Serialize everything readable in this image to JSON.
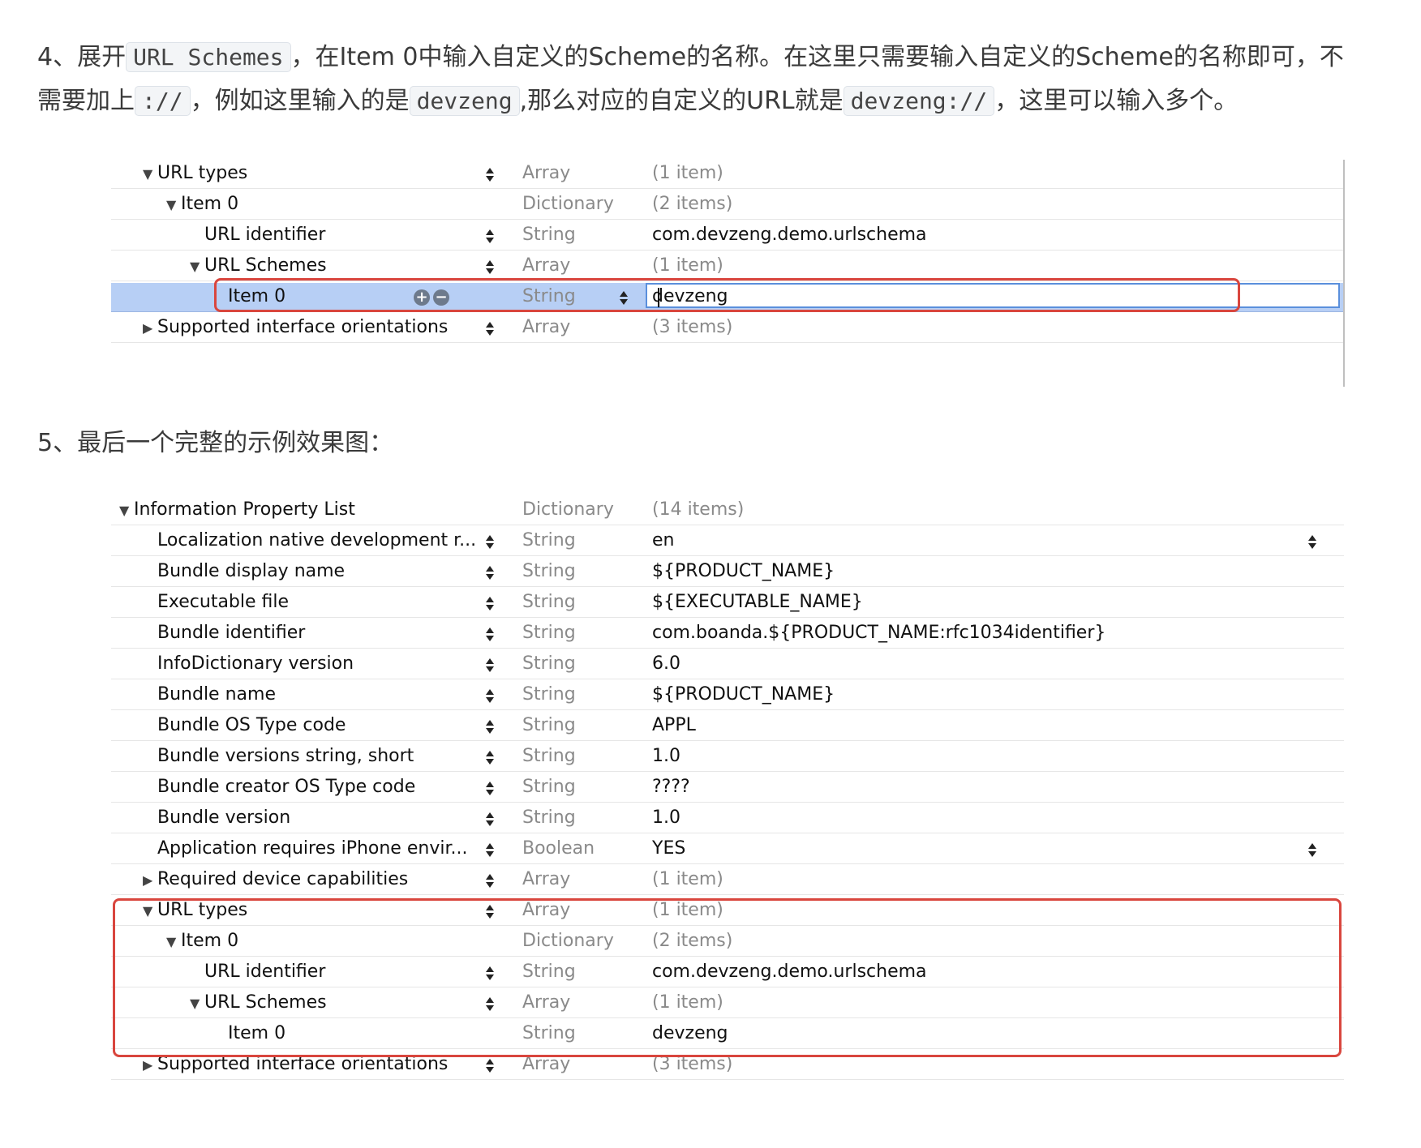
{
  "step4": {
    "line1": [
      {
        "t": "4、展开",
        "code": false
      },
      {
        "t": "URL Schemes",
        "code": true
      },
      {
        "t": "，在Item 0中输入自定义的Scheme的名称。在这里只需要输入自定义的Scheme的名称即可，不",
        "code": false
      }
    ],
    "line2": [
      {
        "t": "需要加上",
        "code": false
      },
      {
        "t": "://",
        "code": true
      },
      {
        "t": "，例如这里输入的是",
        "code": false
      },
      {
        "t": "devzeng",
        "code": true
      },
      {
        "t": ",那么对应的自定义的URL就是",
        "code": false
      },
      {
        "t": "devzeng://",
        "code": true
      },
      {
        "t": "，这里可以输入多个。",
        "code": false
      }
    ]
  },
  "plist1": {
    "rows": [
      {
        "key": "URL types",
        "indent": 0,
        "tri": "down",
        "stepper": true,
        "type": "Array",
        "value": "(1 item)",
        "vgrey": true
      },
      {
        "key": "Item 0",
        "indent": 1,
        "tri": "down",
        "stepper": false,
        "type": "Dictionary",
        "value": "(2 items)",
        "vgrey": true
      },
      {
        "key": "URL identifier",
        "indent": 2,
        "tri": "",
        "stepper": true,
        "type": "String",
        "value": "com.devzeng.demo.urlschema",
        "vgrey": false
      },
      {
        "key": "URL Schemes",
        "indent": 2,
        "tri": "down",
        "stepper": true,
        "type": "Array",
        "value": "(1 item)",
        "vgrey": true
      },
      {
        "key": "Item 0",
        "indent": 3,
        "tri": "",
        "stepper": false,
        "type": "String",
        "value": "devzeng",
        "vgrey": false,
        "selected": true
      },
      {
        "key": "Supported interface orientations",
        "indent": 0,
        "tri": "right",
        "stepper": true,
        "type": "Array",
        "value": "(3 items)",
        "vgrey": true
      }
    ]
  },
  "step5": {
    "text": "5、最后一个完整的示例效果图："
  },
  "plist2": {
    "rows": [
      {
        "key": "Information Property List",
        "indent": -1,
        "tri": "down",
        "stepper": false,
        "type": "Dictionary",
        "value": "(14 items)",
        "vgrey": true
      },
      {
        "key": "Localization native development r...",
        "indent": 0,
        "tri": "",
        "stepper": true,
        "type": "String",
        "value": "en",
        "vgrey": false,
        "rstep": true
      },
      {
        "key": "Bundle display name",
        "indent": 0,
        "tri": "",
        "stepper": true,
        "type": "String",
        "value": "${PRODUCT_NAME}",
        "vgrey": false
      },
      {
        "key": "Executable file",
        "indent": 0,
        "tri": "",
        "stepper": true,
        "type": "String",
        "value": "${EXECUTABLE_NAME}",
        "vgrey": false
      },
      {
        "key": "Bundle identifier",
        "indent": 0,
        "tri": "",
        "stepper": true,
        "type": "String",
        "value": "com.boanda.${PRODUCT_NAME:rfc1034identifier}",
        "vgrey": false
      },
      {
        "key": "InfoDictionary version",
        "indent": 0,
        "tri": "",
        "stepper": true,
        "type": "String",
        "value": "6.0",
        "vgrey": false
      },
      {
        "key": "Bundle name",
        "indent": 0,
        "tri": "",
        "stepper": true,
        "type": "String",
        "value": "${PRODUCT_NAME}",
        "vgrey": false
      },
      {
        "key": "Bundle OS Type code",
        "indent": 0,
        "tri": "",
        "stepper": true,
        "type": "String",
        "value": "APPL",
        "vgrey": false
      },
      {
        "key": "Bundle versions string, short",
        "indent": 0,
        "tri": "",
        "stepper": true,
        "type": "String",
        "value": "1.0",
        "vgrey": false
      },
      {
        "key": "Bundle creator OS Type code",
        "indent": 0,
        "tri": "",
        "stepper": true,
        "type": "String",
        "value": "????",
        "vgrey": false
      },
      {
        "key": "Bundle version",
        "indent": 0,
        "tri": "",
        "stepper": true,
        "type": "String",
        "value": "1.0",
        "vgrey": false
      },
      {
        "key": "Application requires iPhone envir...",
        "indent": 0,
        "tri": "",
        "stepper": true,
        "type": "Boolean",
        "value": "YES",
        "vgrey": false,
        "rstep": true
      },
      {
        "key": "Required device capabilities",
        "indent": 0,
        "tri": "right",
        "stepper": true,
        "type": "Array",
        "value": "(1 item)",
        "vgrey": true
      },
      {
        "key": "URL types",
        "indent": 0,
        "tri": "down",
        "stepper": true,
        "type": "Array",
        "value": "(1 item)",
        "vgrey": true
      },
      {
        "key": "Item 0",
        "indent": 1,
        "tri": "down",
        "stepper": false,
        "type": "Dictionary",
        "value": "(2 items)",
        "vgrey": true
      },
      {
        "key": "URL identifier",
        "indent": 2,
        "tri": "",
        "stepper": true,
        "type": "String",
        "value": "com.devzeng.demo.urlschema",
        "vgrey": false
      },
      {
        "key": "URL Schemes",
        "indent": 2,
        "tri": "down",
        "stepper": true,
        "type": "Array",
        "value": "(1 item)",
        "vgrey": true
      },
      {
        "key": "Item 0",
        "indent": 3,
        "tri": "",
        "stepper": false,
        "type": "String",
        "value": "devzeng",
        "vgrey": false
      },
      {
        "key": "Supported interface orientations",
        "indent": 0,
        "tri": "right",
        "stepper": true,
        "type": "Array",
        "value": "(3 items)",
        "vgrey": true
      }
    ]
  },
  "colors": {
    "highlight": "#d9463e",
    "selection": "#b7cff5",
    "edit_border": "#5a8fdc"
  }
}
